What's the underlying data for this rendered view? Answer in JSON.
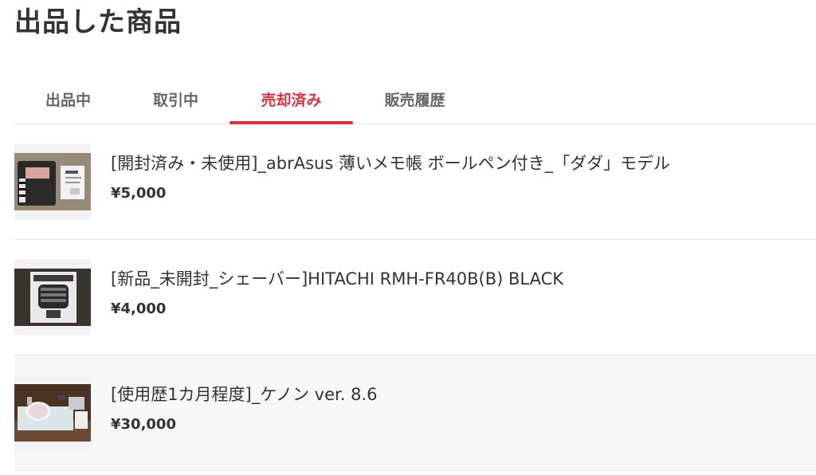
{
  "page": {
    "title": "出品した商品"
  },
  "tabs": [
    {
      "label": "出品中",
      "active": false
    },
    {
      "label": "取引中",
      "active": false
    },
    {
      "label": "売却済み",
      "active": true
    },
    {
      "label": "販売履歴",
      "active": false
    }
  ],
  "items": [
    {
      "name": "[開封済み・未使用]_abrAsus 薄いメモ帳 ボールペン付き_「ダダ」モデル",
      "price": "¥5,000",
      "thumb_icon": "wallet-notebook-photo"
    },
    {
      "name": "[新品_未開封_シェーバー]HITACHI RMH-FR40B(B) BLACK",
      "price": "¥4,000",
      "thumb_icon": "shaver-box-photo"
    },
    {
      "name": "[使用歴1カ月程度]_ケノン ver. 8.6",
      "price": "¥30,000",
      "thumb_icon": "hair-removal-device-photo"
    }
  ],
  "colors": {
    "accent": "#e0303f",
    "text": "#333333",
    "tab_inactive": "#666666",
    "divider": "#e6e6e6"
  }
}
